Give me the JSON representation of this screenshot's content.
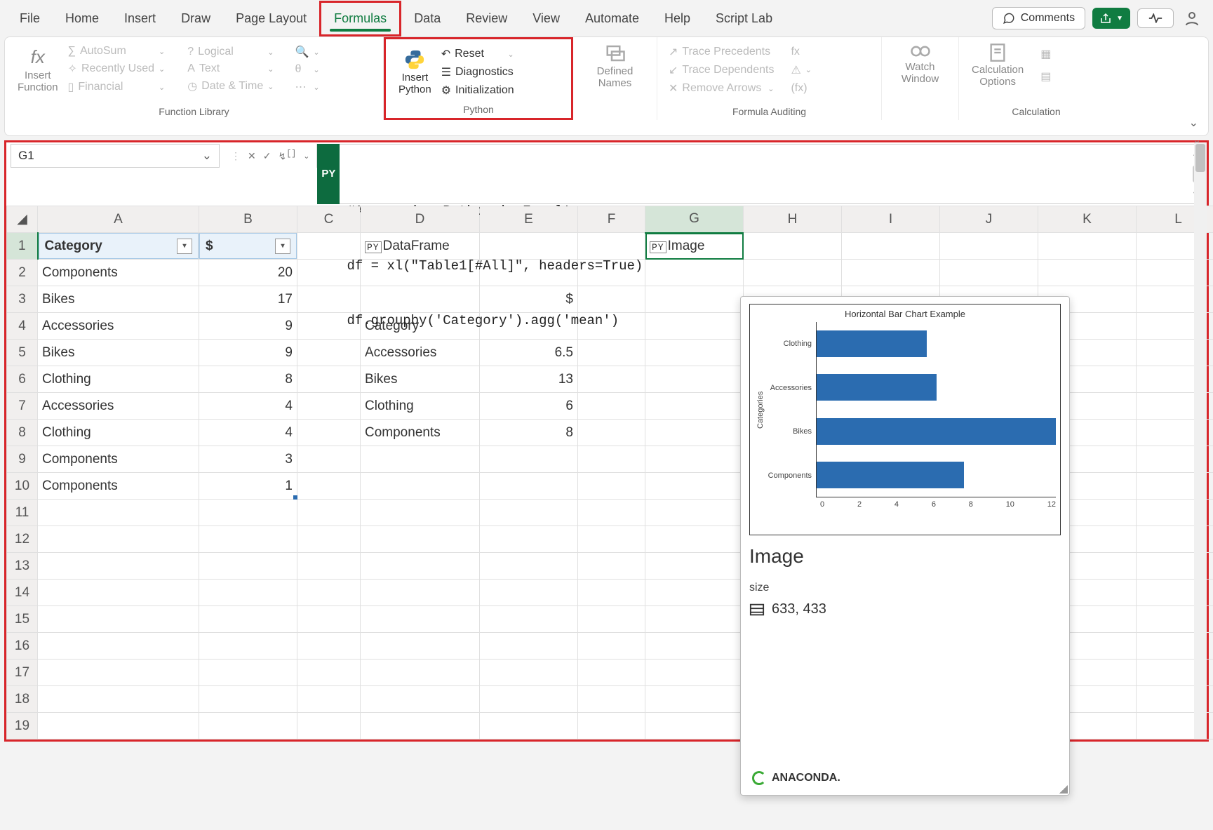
{
  "tabs": [
    "File",
    "Home",
    "Insert",
    "Draw",
    "Page Layout",
    "Formulas",
    "Data",
    "Review",
    "View",
    "Automate",
    "Help",
    "Script Lab"
  ],
  "active_tab": "Formulas",
  "header_buttons": {
    "comments": "Comments"
  },
  "ribbon": {
    "function_library": {
      "label": "Function Library",
      "insert_function": "Insert\nFunction",
      "items_col1": [
        "AutoSum",
        "Recently Used",
        "Financial"
      ],
      "items_col2": [
        "Logical",
        "Text",
        "Date & Time"
      ]
    },
    "python": {
      "label": "Python",
      "insert_python": "Insert\nPython",
      "reset": "Reset",
      "diagnostics": "Diagnostics",
      "initialization": "Initialization"
    },
    "defined_names": {
      "label": "Defined\nNames"
    },
    "formula_auditing": {
      "label": "Formula Auditing",
      "trace_precedents": "Trace Precedents",
      "trace_dependents": "Trace Dependents",
      "remove_arrows": "Remove Arrows"
    },
    "watch_window": "Watch\nWindow",
    "calculation": {
      "label": "Calculation",
      "options": "Calculation\nOptions"
    }
  },
  "namebox": "G1",
  "formula_lines": [
    "#Announcing Python in Excel!",
    "df = xl(\"Table1[#All]\", headers=True)",
    "df.groupby('Category').agg('mean')"
  ],
  "columns": [
    "A",
    "B",
    "C",
    "D",
    "E",
    "F",
    "G",
    "H",
    "I",
    "J",
    "K",
    "L"
  ],
  "active_column": "G",
  "active_row": 1,
  "table": {
    "header": {
      "A": "Category",
      "B": "$"
    },
    "rows": [
      {
        "A": "Components",
        "B": 20
      },
      {
        "A": "Bikes",
        "B": 17
      },
      {
        "A": "Accessories",
        "B": 9
      },
      {
        "A": "Bikes",
        "B": 9
      },
      {
        "A": "Clothing",
        "B": 8
      },
      {
        "A": "Accessories",
        "B": 4
      },
      {
        "A": "Clothing",
        "B": 4
      },
      {
        "A": "Components",
        "B": 3
      },
      {
        "A": "Components",
        "B": 1
      }
    ]
  },
  "dataframe_output": {
    "D1": "DataFrame",
    "E3": "$",
    "D4": "Category",
    "rows": [
      {
        "D": "Accessories",
        "E": 6.5
      },
      {
        "D": "Bikes",
        "E": 13
      },
      {
        "D": "Clothing",
        "E": 6
      },
      {
        "D": "Components",
        "E": 8
      }
    ]
  },
  "g1_value": "Image",
  "card": {
    "title": "Image",
    "size_label": "size",
    "size_value": "633, 433",
    "anaconda": "ANACONDA."
  },
  "chart_data": {
    "type": "bar",
    "orientation": "horizontal",
    "title": "Horizontal Bar Chart Example",
    "ylabel": "Categories",
    "categories": [
      "Clothing",
      "Accessories",
      "Bikes",
      "Components"
    ],
    "values": [
      6,
      6.5,
      13,
      8
    ],
    "xlim": [
      0,
      13
    ],
    "xticks": [
      0,
      2,
      4,
      6,
      8,
      10,
      12
    ]
  },
  "row_count": 19
}
